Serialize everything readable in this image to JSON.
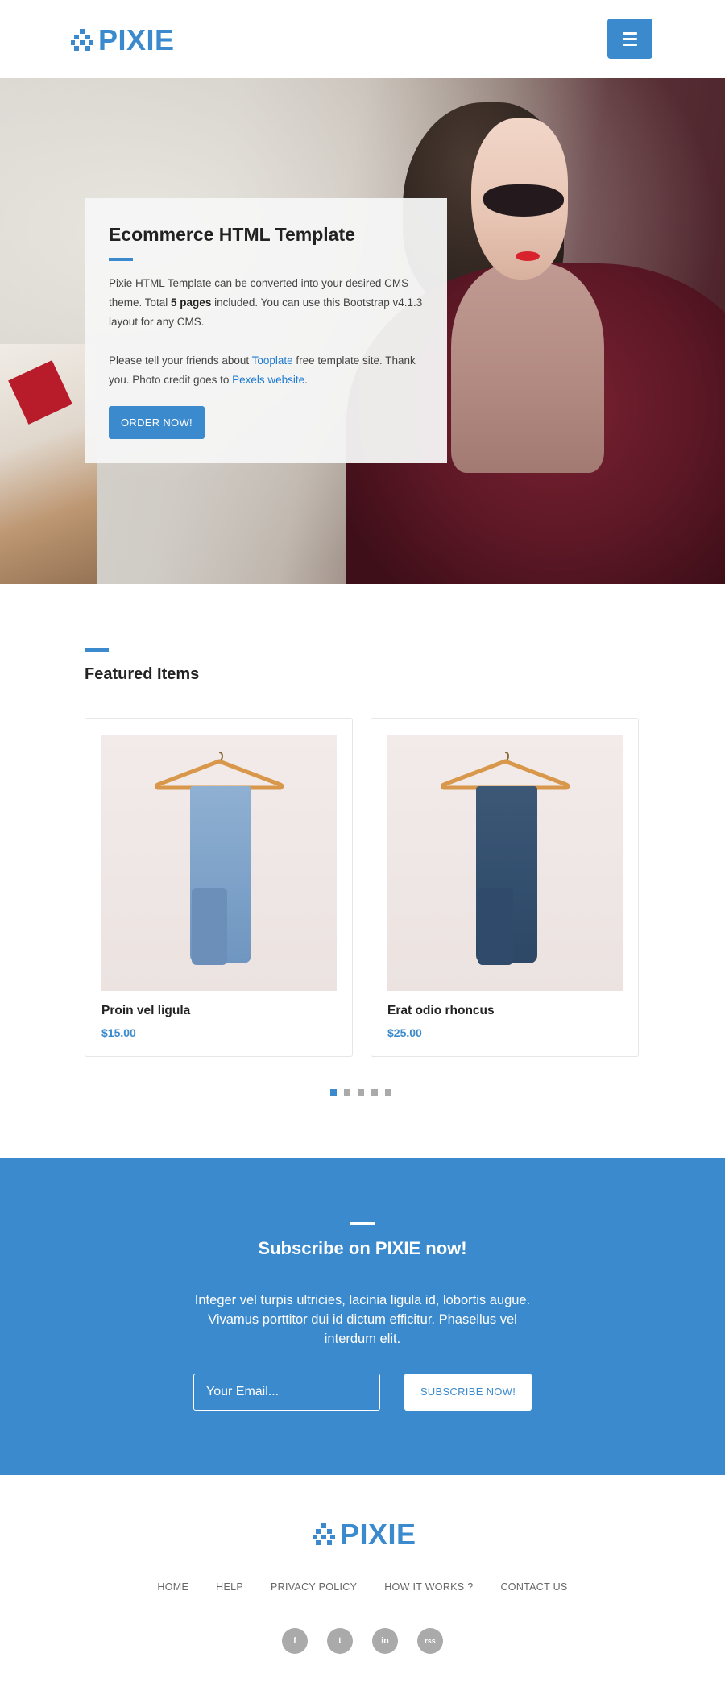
{
  "header": {
    "logo_text": "PIXIE",
    "menu_icon": "hamburger-menu-icon",
    "brand_color": "#3a8acd"
  },
  "hero": {
    "title": "Ecommerce HTML Template",
    "p1_a": "Pixie HTML Template can be converted into your desired CMS theme. Total ",
    "p1_bold": "5 pages",
    "p1_b": " included. You can use this Bootstrap v4.1.3 layout for any CMS.",
    "p2_a": "Please tell your friends about ",
    "p2_link1": "Tooplate",
    "p2_b": " free template site. Thank you. Photo credit goes to ",
    "p2_link2": "Pexels website",
    "p2_c": ".",
    "cta": "ORDER NOW!"
  },
  "featured": {
    "title": "Featured Items",
    "items": [
      {
        "name": "Proin vel ligula",
        "price": "$15.00",
        "image": "hanging-light-jeans"
      },
      {
        "name": "Erat odio rhoncus",
        "price": "$25.00",
        "image": "hanging-dark-jeans"
      }
    ],
    "pages": 5,
    "active_page": 1
  },
  "subscribe": {
    "title": "Subscribe on PIXIE now!",
    "text": "Integer vel turpis ultricies, lacinia ligula id, lobortis augue. Vivamus porttitor dui id dictum efficitur. Phasellus vel interdum elit.",
    "placeholder": "Your Email...",
    "button": "SUBSCRIBE NOW!"
  },
  "footer": {
    "logo_text": "PIXIE",
    "nav": [
      "HOME",
      "HELP",
      "PRIVACY POLICY",
      "HOW IT WORKS ?",
      "CONTACT US"
    ],
    "social": [
      {
        "icon": "facebook-icon",
        "glyph": "f"
      },
      {
        "icon": "twitter-icon",
        "glyph": "t"
      },
      {
        "icon": "linkedin-icon",
        "glyph": "in"
      },
      {
        "icon": "rss-icon",
        "glyph": "rss"
      }
    ]
  }
}
